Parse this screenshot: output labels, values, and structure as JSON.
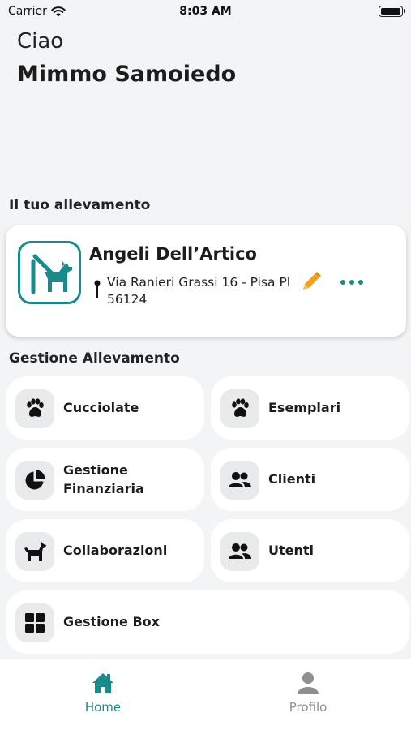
{
  "status": {
    "carrier": "Carrier",
    "time": "8:03 AM"
  },
  "greeting": "Ciao",
  "user_name": "Mimmo Samoiedo",
  "breeding": {
    "section_title": "Il tuo allevamento",
    "name": "Angeli Dell’Artico",
    "address": "Via Ranieri Grassi 16 - Pisa PI 56124"
  },
  "management": {
    "section_title": "Gestione Allevamento",
    "tiles": [
      {
        "label": "Cucciolate",
        "icon": "paw-icon"
      },
      {
        "label": "Esemplari",
        "icon": "paw-icon"
      },
      {
        "label": "Gestione Finanziaria",
        "icon": "pie-chart-icon"
      },
      {
        "label": "Clienti",
        "icon": "people-icon"
      },
      {
        "label": "Collaborazioni",
        "icon": "dog-icon"
      },
      {
        "label": "Utenti",
        "icon": "people-icon"
      },
      {
        "label": "Gestione Box",
        "icon": "grid-icon"
      }
    ]
  },
  "tabs": [
    {
      "label": "Home",
      "icon": "home-icon",
      "active": true
    },
    {
      "label": "Profilo",
      "icon": "person-icon",
      "active": false
    }
  ],
  "colors": {
    "accent": "#1a8a8a",
    "edit": "#f0a21a",
    "inactive_tab": "#8e8e93"
  }
}
